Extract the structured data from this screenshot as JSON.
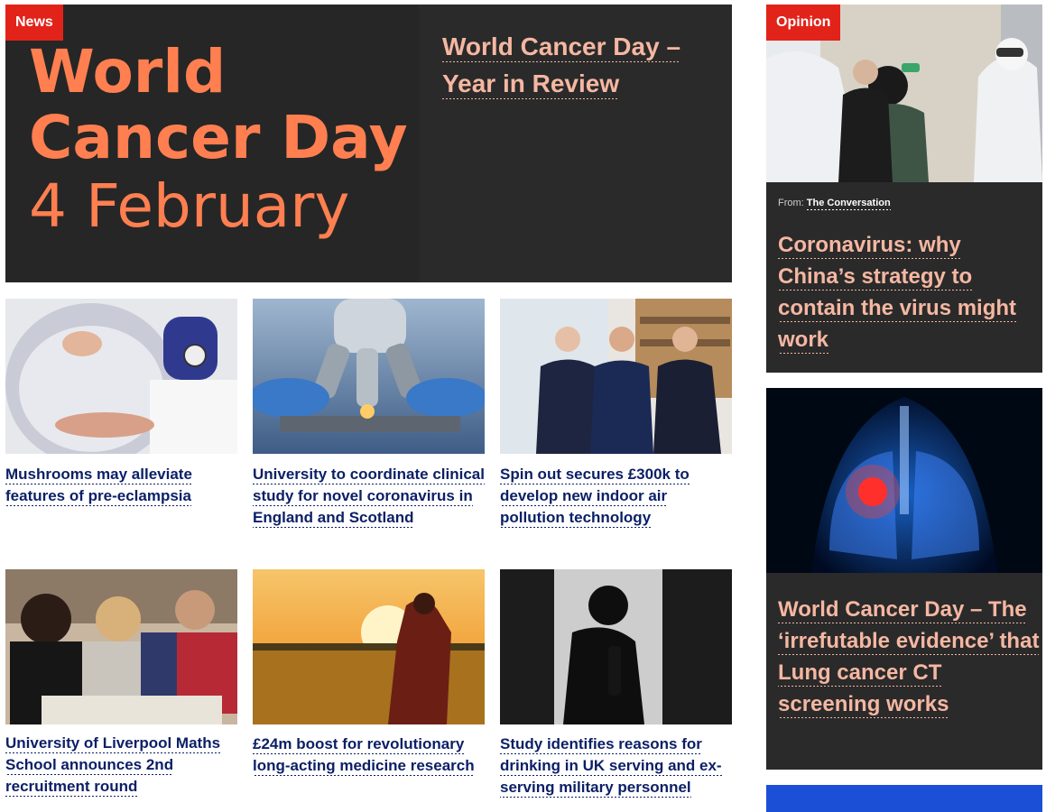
{
  "hero": {
    "badge": "News",
    "art_line1": "World",
    "art_line2": "Cancer Day",
    "art_line3": "4 February",
    "title": "World Cancer Day – Year in Review"
  },
  "cards": [
    {
      "title": "Mushrooms may alleviate features of pre-eclampsia"
    },
    {
      "title": "University to coordinate clinical study for novel coronavirus in England and Scotland"
    },
    {
      "title": "Spin out secures £300k to develop new indoor air pollution technology"
    },
    {
      "title": "University of Liverpool Maths School announces 2nd recruitment round"
    },
    {
      "title": "£24m boost for revolutionary long-acting medicine research"
    },
    {
      "title": "Study identifies reasons for drinking in UK serving and ex-serving military personnel"
    }
  ],
  "sidebar": {
    "opinion": {
      "badge": "Opinion",
      "from_label": "From:",
      "source": "The Conversation",
      "title": "Coronavirus: why China’s strategy to contain the virus might work"
    },
    "lung": {
      "title": "World Cancer Day – The ‘irrefutable evidence’ that Lung cancer CT screening works"
    }
  },
  "colors": {
    "badge": "#e2231a",
    "dark_panel": "#2a2a2a",
    "hero_accent": "#ff7f50",
    "headline_pink": "#f5b7a2",
    "link_navy": "#0b1f66"
  }
}
